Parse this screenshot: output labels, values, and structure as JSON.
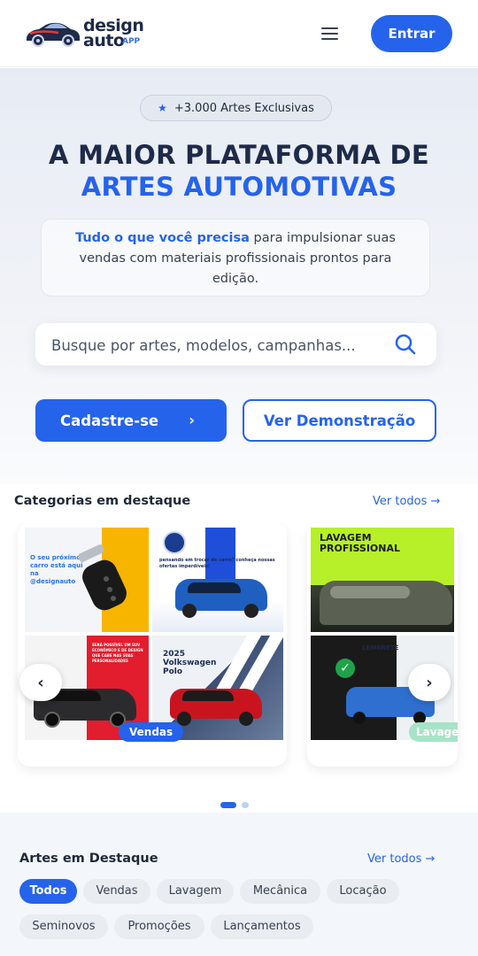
{
  "header": {
    "logo_line1": "design",
    "logo_line2": "auto",
    "logo_suffix": "APP",
    "menu_icon": "hamburger-icon",
    "login_label": "Entrar"
  },
  "hero": {
    "badge": "+3.000 Artes Exclusivas",
    "title_line1": "A MAIOR PLATAFORMA DE",
    "title_line2": "ARTES AUTOMOTIVAS",
    "desc_highlight": "Tudo o que você precisa",
    "desc_rest": " para impulsionar suas vendas com materiais profissionais prontos para edição.",
    "search_placeholder": "Busque por artes, modelos, campanhas...",
    "signup_label": "Cadastre-se",
    "signup_chevron": "›",
    "demo_label": "Ver Demonstração"
  },
  "categories": {
    "title": "Categorias em destaque",
    "see_all": "Ver todos →",
    "cards": [
      {
        "tag": "Vendas",
        "tiles": [
          {
            "text": "O seu próximo carro está aqui na @designauto"
          },
          {
            "text": "pensando em trocar de carro? conheça nossas ofertas imperdíveis!"
          },
          {
            "text": "SERÁ POSSÍVEL UM SUV ECONÔMICO E DE DESIGN QUE CABE NAS SUAS PERSONALIDADES"
          },
          {
            "text": "2025 Volkswagen Polo"
          }
        ]
      },
      {
        "tag": "Lavagem",
        "tiles": [
          {
            "text": "LAVAGEM PROFISSIONAL"
          },
          {
            "text": "LEMBRETE"
          }
        ]
      }
    ],
    "prev_icon": "‹",
    "next_icon": "›",
    "dots": [
      true,
      false
    ]
  },
  "featured": {
    "title": "Artes em Destaque",
    "see_all": "Ver todos →",
    "filters": [
      {
        "label": "Todos",
        "active": true
      },
      {
        "label": "Vendas",
        "active": false
      },
      {
        "label": "Lavagem",
        "active": false
      },
      {
        "label": "Mecânica",
        "active": false
      },
      {
        "label": "Locação",
        "active": false
      },
      {
        "label": "Seminovos",
        "active": false
      },
      {
        "label": "Promoções",
        "active": false
      },
      {
        "label": "Lançamentos",
        "active": false
      }
    ]
  },
  "colors": {
    "primary": "#2563eb",
    "navy": "#1e2a4a",
    "lime": "#b7f028"
  }
}
